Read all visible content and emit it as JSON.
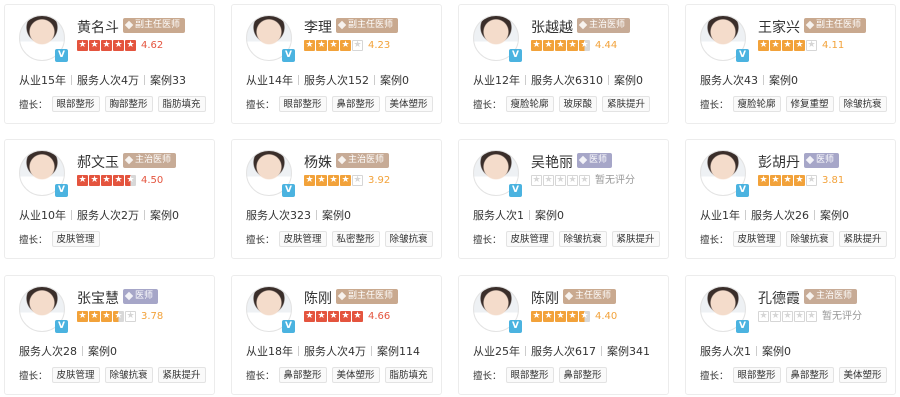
{
  "common": {
    "skills_label": "擅长：",
    "verified_badge": "V"
  },
  "doctors": [
    {
      "name": "黄名斗",
      "title": "副主任医师",
      "rating": "4.62",
      "stats": [
        "从业15年",
        "服务人次4万",
        "案例33"
      ],
      "skills": [
        "眼部整形",
        "胸部整形",
        "脂肪填充"
      ]
    },
    {
      "name": "李理",
      "title": "副主任医师",
      "rating": "4.23",
      "stats": [
        "从业14年",
        "服务人次152",
        "案例0"
      ],
      "skills": [
        "眼部整形",
        "鼻部整形",
        "美体塑形"
      ]
    },
    {
      "name": "张越越",
      "title": "主治医师",
      "rating": "4.44",
      "stats": [
        "从业12年",
        "服务人次6310",
        "案例0"
      ],
      "skills": [
        "瘦脸轮廓",
        "玻尿酸",
        "紧肤提升"
      ]
    },
    {
      "name": "王家兴",
      "title": "副主任医师",
      "rating": "4.11",
      "stats": [
        "服务人次43",
        "案例0"
      ],
      "skills": [
        "瘦脸轮廓",
        "修复重塑",
        "除皱抗衰"
      ]
    },
    {
      "name": "郝文玉",
      "title": "主治医师",
      "rating": "4.50",
      "stats": [
        "从业10年",
        "服务人次2万",
        "案例0"
      ],
      "skills": [
        "皮肤管理"
      ]
    },
    {
      "name": "杨姝",
      "title": "主治医师",
      "rating": "3.92",
      "stats": [
        "服务人次323",
        "案例0"
      ],
      "skills": [
        "皮肤管理",
        "私密整形",
        "除皱抗衰"
      ]
    },
    {
      "name": "吴艳丽",
      "title": "医师",
      "rating": "暂无评分",
      "stats": [
        "服务人次1",
        "案例0"
      ],
      "skills": [
        "皮肤管理",
        "除皱抗衰",
        "紧肤提升"
      ]
    },
    {
      "name": "彭胡丹",
      "title": "医师",
      "rating": "3.81",
      "stats": [
        "从业1年",
        "服务人次26",
        "案例0"
      ],
      "skills": [
        "皮肤管理",
        "除皱抗衰",
        "紧肤提升"
      ]
    },
    {
      "name": "张宝慧",
      "title": "医师",
      "rating": "3.78",
      "stats": [
        "服务人次28",
        "案例0"
      ],
      "skills": [
        "皮肤管理",
        "除皱抗衰",
        "紧肤提升"
      ]
    },
    {
      "name": "陈刚",
      "title": "副主任医师",
      "rating": "4.66",
      "stats": [
        "从业18年",
        "服务人次4万",
        "案例114"
      ],
      "skills": [
        "鼻部整形",
        "美体塑形",
        "脂肪填充"
      ]
    },
    {
      "name": "陈刚",
      "title": "主任医师",
      "rating": "4.40",
      "stats": [
        "从业25年",
        "服务人次617",
        "案例341"
      ],
      "skills": [
        "眼部整形",
        "鼻部整形"
      ]
    },
    {
      "name": "孔德霞",
      "title": "主治医师",
      "rating": "暂无评分",
      "stats": [
        "服务人次1",
        "案例0"
      ],
      "skills": [
        "眼部整形",
        "鼻部整形",
        "美体塑形"
      ]
    }
  ],
  "star_fill": [
    5,
    4,
    4.5,
    4,
    4.5,
    4,
    0,
    4,
    3.5,
    5,
    4.5,
    0
  ],
  "star_colors": [
    "red",
    "orange",
    "orange",
    "orange",
    "red",
    "orange",
    "empty",
    "orange",
    "orange",
    "red",
    "orange",
    "empty"
  ],
  "title_colors": {
    "副主任医师": "#c9a98f",
    "主治医师": "#c7ab96",
    "主任医师": "#c9a98f",
    "医师": "#a6a6c8"
  }
}
